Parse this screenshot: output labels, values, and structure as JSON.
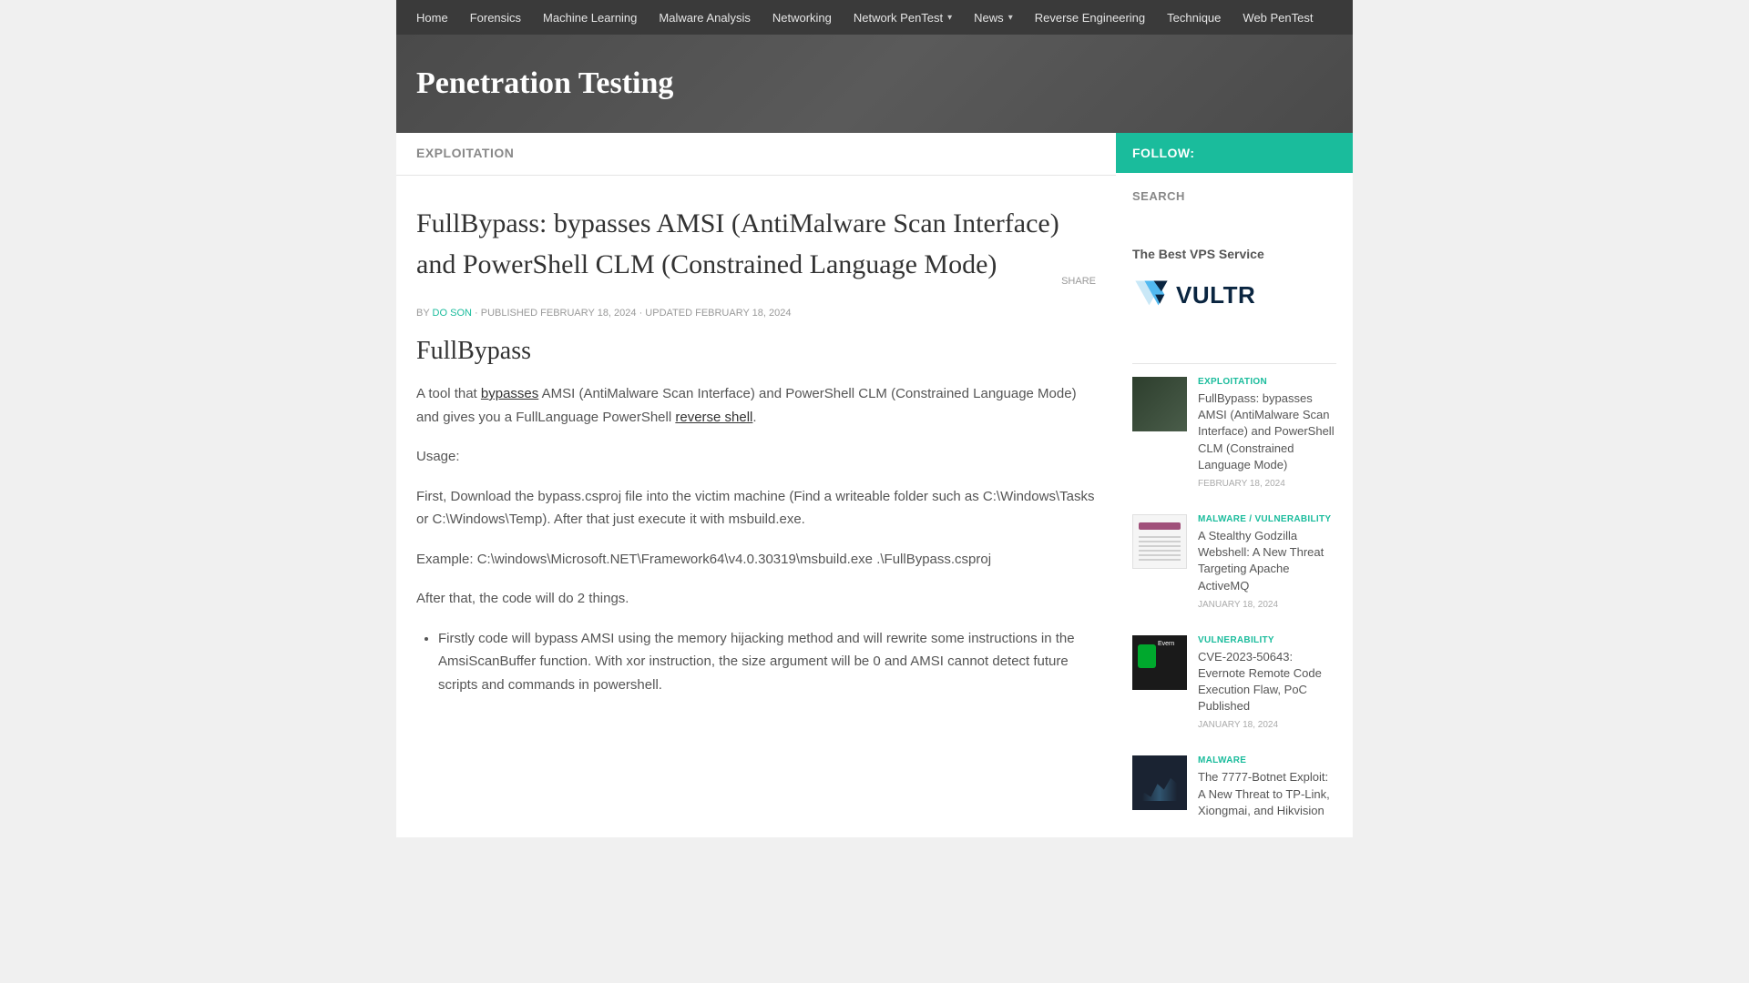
{
  "nav": {
    "items": [
      {
        "label": "Home",
        "arrow": false
      },
      {
        "label": "Forensics",
        "arrow": false
      },
      {
        "label": "Machine Learning",
        "arrow": false
      },
      {
        "label": "Malware Analysis",
        "arrow": false
      },
      {
        "label": "Networking",
        "arrow": false
      },
      {
        "label": "Network PenTest",
        "arrow": true
      },
      {
        "label": "News",
        "arrow": true
      },
      {
        "label": "Reverse Engineering",
        "arrow": false
      },
      {
        "label": "Technique",
        "arrow": false
      },
      {
        "label": "Web PenTest",
        "arrow": false
      }
    ]
  },
  "hero": {
    "title": "Penetration Testing"
  },
  "article": {
    "category": "EXPLOITATION",
    "title": "FullBypass: bypasses AMSI (AntiMalware Scan Interface) and PowerShell CLM (Constrained Language Mode)",
    "meta_by": "BY",
    "meta_author": "DO SON",
    "meta_published": " · PUBLISHED FEBRUARY 18, 2024 · UPDATED FEBRUARY 18, 2024",
    "share_label": "SHARE",
    "heading": "FullBypass",
    "intro_pre": "A tool that ",
    "intro_link1": "bypasses",
    "intro_mid": " AMSI (AntiMalware Scan Interface) and PowerShell CLM (Constrained Language Mode) and gives you a FullLanguage PowerShell ",
    "intro_link2": "reverse shell",
    "intro_post": ".",
    "usage_label": "Usage:",
    "step1": "First, Download the bypass.csproj file into the victim machine (Find a writeable folder such as C:\\Windows\\Tasks or C:\\Windows\\Temp). After that just execute it with msbuild.exe.",
    "step2": "Example: C:\\windows\\Microsoft.NET\\Framework64\\v4.0.30319\\msbuild.exe .\\FullBypass.csproj",
    "step3": "After that, the code will do 2 things.",
    "bullet1": "Firstly code will bypass AMSI using the memory hijacking method and will rewrite some instructions in the AmsiScanBuffer function. With xor instruction, the size argument will be 0 and AMSI cannot detect future scripts and commands in powershell."
  },
  "sidebar": {
    "follow": "FOLLOW:",
    "search": "SEARCH",
    "vps_heading": "The Best VPS Service",
    "vps_name": "VULTR",
    "posts": [
      {
        "category": "EXPLOITATION",
        "title": "FullBypass: bypasses AMSI (AntiMalware Scan Interface) and PowerShell CLM (Constrained Language Mode)",
        "date": "FEBRUARY 18, 2024"
      },
      {
        "category": "MALWARE / VULNERABILITY",
        "title": "A Stealthy Godzilla Webshell: A New Threat Targeting Apache ActiveMQ",
        "date": "JANUARY 18, 2024"
      },
      {
        "category": "VULNERABILITY",
        "title": "CVE-2023-50643: Evernote Remote Code Execution Flaw, PoC Published",
        "date": "JANUARY 18, 2024"
      },
      {
        "category": "MALWARE",
        "title": "The 7777-Botnet Exploit: A New Threat to TP-Link, Xiongmai, and Hikvision",
        "date": ""
      }
    ]
  }
}
